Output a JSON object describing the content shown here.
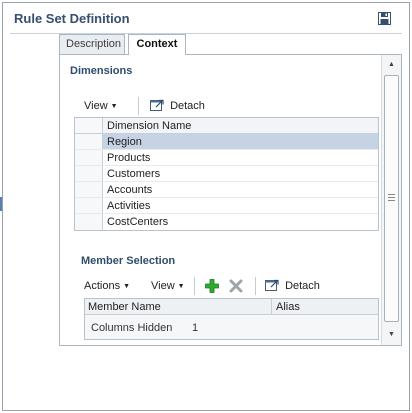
{
  "page": {
    "title": "Rule Set Definition",
    "save_icon": "save-icon"
  },
  "tabs": [
    {
      "label": "Description",
      "selected": false
    },
    {
      "label": "Context",
      "selected": true
    }
  ],
  "dimensions": {
    "heading": "Dimensions",
    "toolbar": {
      "view_label": "View",
      "detach_label": "Detach"
    },
    "columns": [
      "Dimension Name"
    ],
    "rows": [
      "Region",
      "Products",
      "Customers",
      "Accounts",
      "Activities",
      "CostCenters"
    ],
    "selected_row": "Region"
  },
  "member_selection": {
    "heading": "Member Selection",
    "toolbar": {
      "actions_label": "Actions",
      "view_label": "View",
      "add_icon": "add-icon",
      "delete_icon": "delete-icon",
      "detach_label": "Detach"
    },
    "columns": [
      "Member Name",
      "Alias"
    ],
    "footer": {
      "label": "Columns Hidden",
      "value": "1"
    }
  },
  "colors": {
    "accent": "#35506f",
    "selection": "#c5d3e4",
    "add": "#2eaa2e"
  }
}
